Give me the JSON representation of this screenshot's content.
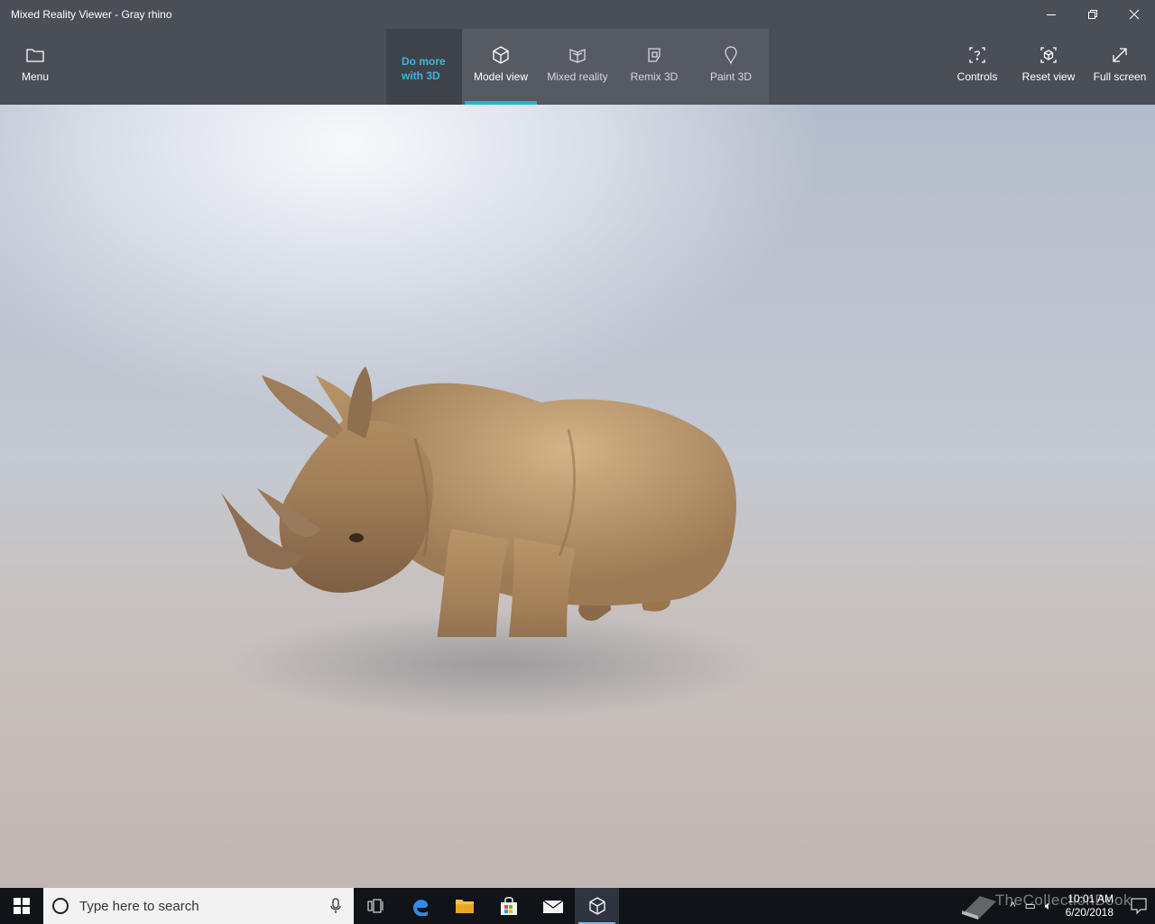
{
  "window": {
    "title": "Mixed Reality Viewer - Gray rhino"
  },
  "toolbar": {
    "menu_label": "Menu",
    "do_more_line1": "Do more",
    "do_more_line2": "with 3D",
    "tabs": [
      {
        "label": "Model view",
        "icon": "cube-icon",
        "active": true
      },
      {
        "label": "Mixed reality",
        "icon": "mixed-reality-icon"
      },
      {
        "label": "Remix 3D",
        "icon": "remix-3d-icon"
      },
      {
        "label": "Paint 3D",
        "icon": "paint-3d-icon"
      }
    ],
    "right": [
      {
        "label": "Controls",
        "icon": "controls-help-icon"
      },
      {
        "label": "Reset view",
        "icon": "reset-view-icon"
      },
      {
        "label": "Full screen",
        "icon": "full-screen-icon"
      }
    ]
  },
  "viewport": {
    "model_name": "Gray rhino"
  },
  "taskbar": {
    "search_placeholder": "Type here to search",
    "watermark": "TheCollectionBook",
    "time": "10:01 AM",
    "date": "6/20/2018"
  },
  "colors": {
    "accent": "#20b7c7",
    "do_more_text": "#3fb6d9",
    "toolbar_bg": "#4a4f57"
  }
}
